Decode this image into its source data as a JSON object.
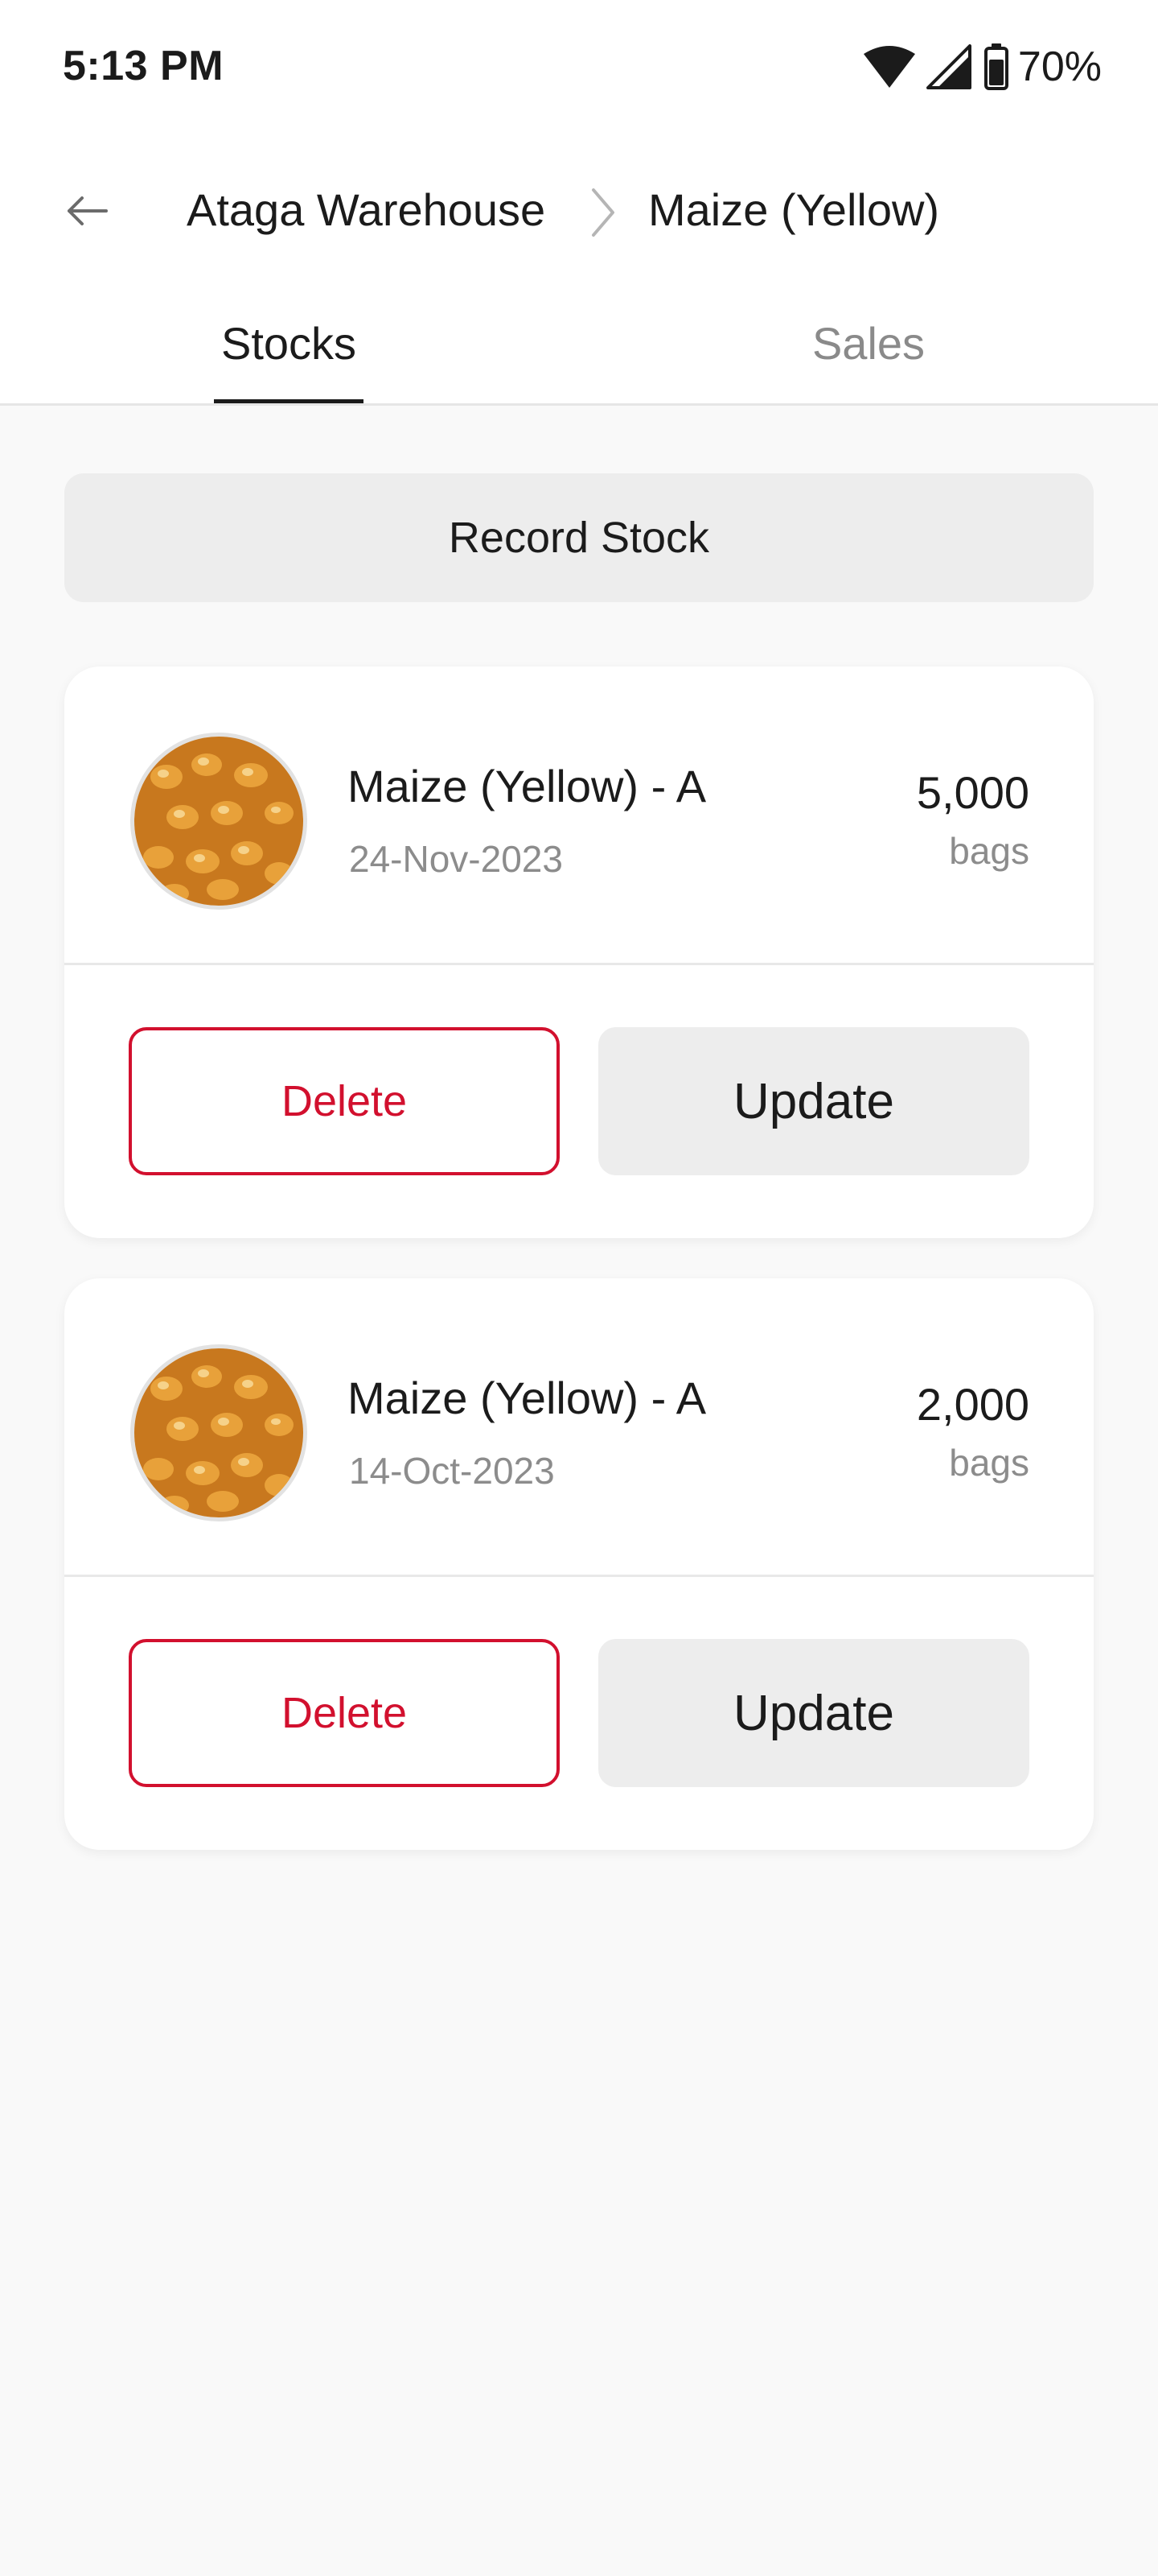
{
  "status_bar": {
    "time": "5:13 PM",
    "battery_percent": "70%",
    "icons": [
      "wifi-icon",
      "cellular-signal-icon",
      "battery-icon"
    ]
  },
  "header": {
    "back_icon": "arrow-left-icon",
    "breadcrumb_parent": "Ataga Warehouse",
    "breadcrumb_separator_icon": "chevron-right-icon",
    "breadcrumb_current": "Maize (Yellow)"
  },
  "tabs": [
    {
      "label": "Stocks",
      "active": true
    },
    {
      "label": "Sales",
      "active": false
    }
  ],
  "record_stock_label": "Record Stock",
  "stocks": [
    {
      "name": "Maize (Yellow) - A",
      "date": "24-Nov-2023",
      "quantity": "5,000",
      "unit": "bags",
      "delete_label": "Delete",
      "update_label": "Update"
    },
    {
      "name": "Maize (Yellow) - A",
      "date": "14-Oct-2023",
      "quantity": "2,000",
      "unit": "bags",
      "delete_label": "Delete",
      "update_label": "Update"
    }
  ],
  "colors": {
    "accent_delete": "#d2102e",
    "button_neutral": "#ededed",
    "background": "#f9f9f9",
    "muted_text": "#8c8c8c"
  }
}
